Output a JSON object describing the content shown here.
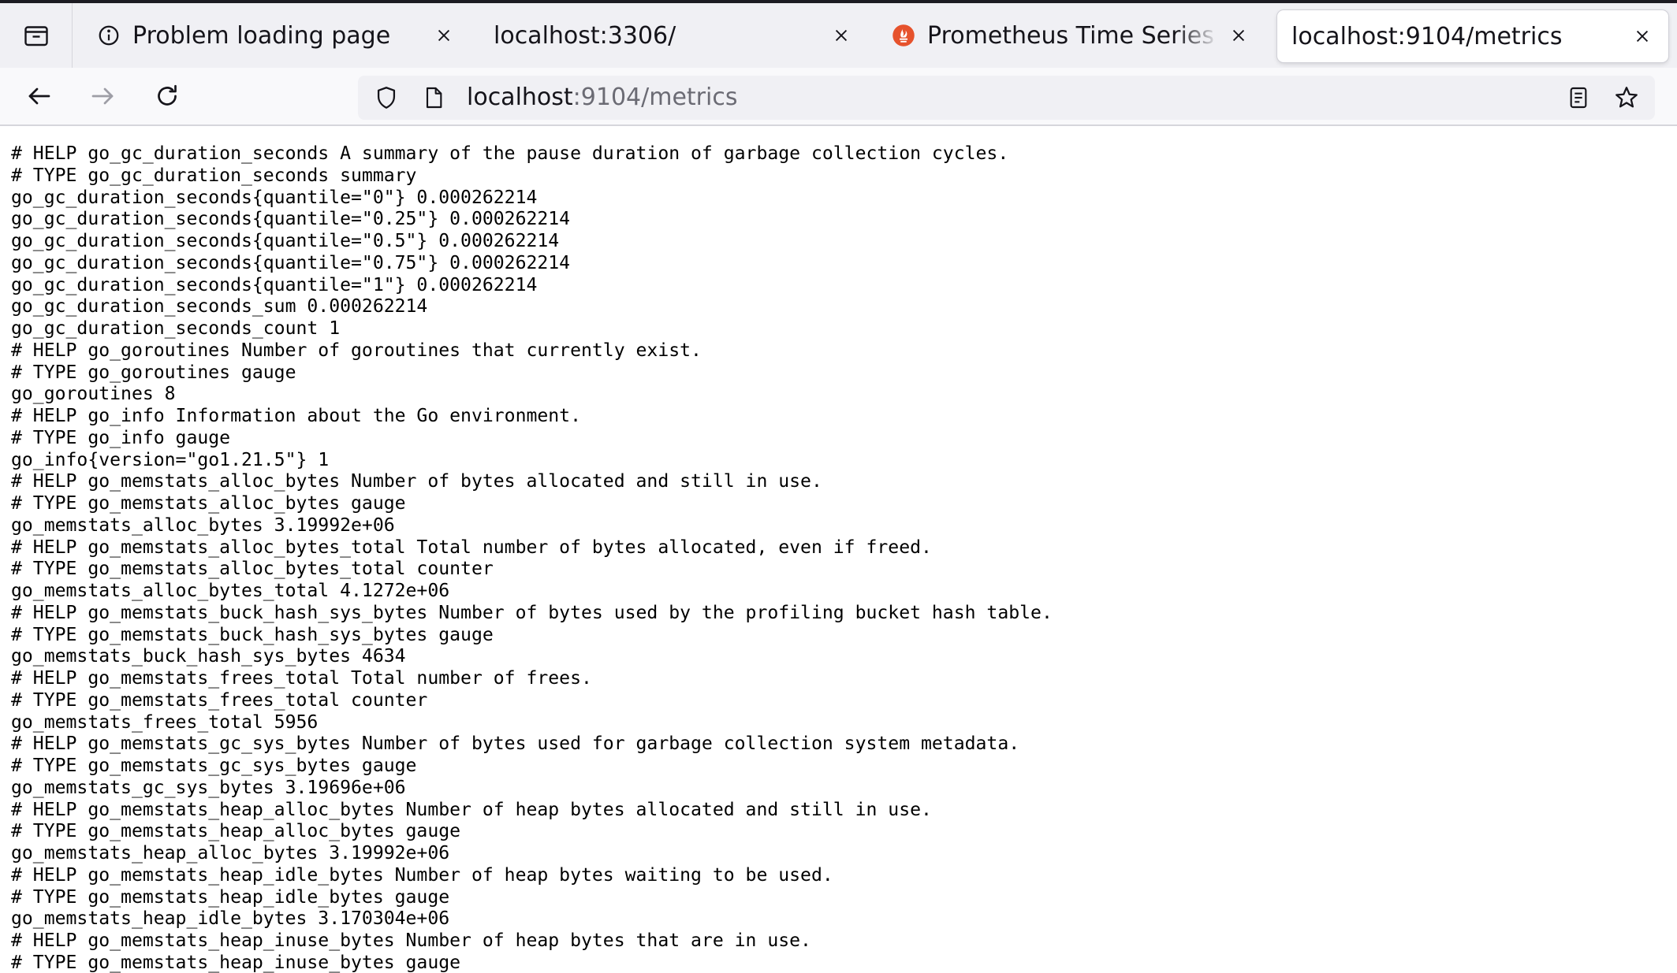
{
  "browser": {
    "tabs": [
      {
        "title": "Problem loading page",
        "icon": "info-icon",
        "active": false
      },
      {
        "title": "localhost:3306/",
        "icon": "",
        "active": false
      },
      {
        "title": "Prometheus Time Series Collection and Processing Server",
        "icon": "prometheus-icon",
        "active": false
      },
      {
        "title": "localhost:9104/metrics",
        "icon": "",
        "active": true
      }
    ],
    "url": {
      "host": "localhost",
      "path": ":9104/metrics"
    }
  },
  "page": {
    "lines": [
      "# HELP go_gc_duration_seconds A summary of the pause duration of garbage collection cycles.",
      "# TYPE go_gc_duration_seconds summary",
      "go_gc_duration_seconds{quantile=\"0\"} 0.000262214",
      "go_gc_duration_seconds{quantile=\"0.25\"} 0.000262214",
      "go_gc_duration_seconds{quantile=\"0.5\"} 0.000262214",
      "go_gc_duration_seconds{quantile=\"0.75\"} 0.000262214",
      "go_gc_duration_seconds{quantile=\"1\"} 0.000262214",
      "go_gc_duration_seconds_sum 0.000262214",
      "go_gc_duration_seconds_count 1",
      "# HELP go_goroutines Number of goroutines that currently exist.",
      "# TYPE go_goroutines gauge",
      "go_goroutines 8",
      "# HELP go_info Information about the Go environment.",
      "# TYPE go_info gauge",
      "go_info{version=\"go1.21.5\"} 1",
      "# HELP go_memstats_alloc_bytes Number of bytes allocated and still in use.",
      "# TYPE go_memstats_alloc_bytes gauge",
      "go_memstats_alloc_bytes 3.19992e+06",
      "# HELP go_memstats_alloc_bytes_total Total number of bytes allocated, even if freed.",
      "# TYPE go_memstats_alloc_bytes_total counter",
      "go_memstats_alloc_bytes_total 4.1272e+06",
      "# HELP go_memstats_buck_hash_sys_bytes Number of bytes used by the profiling bucket hash table.",
      "# TYPE go_memstats_buck_hash_sys_bytes gauge",
      "go_memstats_buck_hash_sys_bytes 4634",
      "# HELP go_memstats_frees_total Total number of frees.",
      "# TYPE go_memstats_frees_total counter",
      "go_memstats_frees_total 5956",
      "# HELP go_memstats_gc_sys_bytes Number of bytes used for garbage collection system metadata.",
      "# TYPE go_memstats_gc_sys_bytes gauge",
      "go_memstats_gc_sys_bytes 3.19696e+06",
      "# HELP go_memstats_heap_alloc_bytes Number of heap bytes allocated and still in use.",
      "# TYPE go_memstats_heap_alloc_bytes gauge",
      "go_memstats_heap_alloc_bytes 3.19992e+06",
      "# HELP go_memstats_heap_idle_bytes Number of heap bytes waiting to be used.",
      "# TYPE go_memstats_heap_idle_bytes gauge",
      "go_memstats_heap_idle_bytes 3.170304e+06",
      "# HELP go_memstats_heap_inuse_bytes Number of heap bytes that are in use.",
      "# TYPE go_memstats_heap_inuse_bytes gauge"
    ]
  }
}
